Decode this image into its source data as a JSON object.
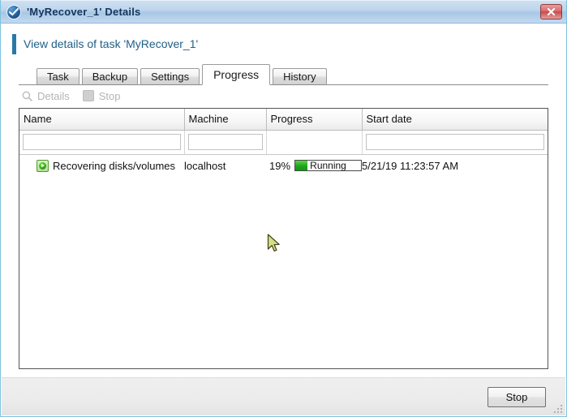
{
  "window": {
    "title": "'MyRecover_1' Details",
    "icon": "acronis-shield-icon",
    "close_label": "Close"
  },
  "header": {
    "title": "View details of task 'MyRecover_1'",
    "accent_color": "#2879a8"
  },
  "tabs": [
    {
      "label": "Task",
      "active": false
    },
    {
      "label": "Backup",
      "active": false
    },
    {
      "label": "Settings",
      "active": false
    },
    {
      "label": "Progress",
      "active": true
    },
    {
      "label": "History",
      "active": false
    }
  ],
  "toolbar": {
    "details_label": "Details",
    "stop_label": "Stop",
    "enabled": false
  },
  "table": {
    "columns": [
      "Name",
      "Machine",
      "Progress",
      "Start date"
    ],
    "filters": {
      "name": "",
      "machine": "",
      "start_date": ""
    },
    "rows": [
      {
        "status_icon": "running-green-icon",
        "name": "Recovering disks/volumes",
        "machine": "localhost",
        "progress_percent": "19%",
        "progress_value": 19,
        "progress_state": "Running",
        "start_date": "5/21/19 11:23:57 AM"
      }
    ]
  },
  "footer": {
    "stop_label": "Stop"
  },
  "colors": {
    "progress_fill": "#1fa41f",
    "titlebar": "#bdd5ec",
    "close_button": "#c94a4a"
  }
}
